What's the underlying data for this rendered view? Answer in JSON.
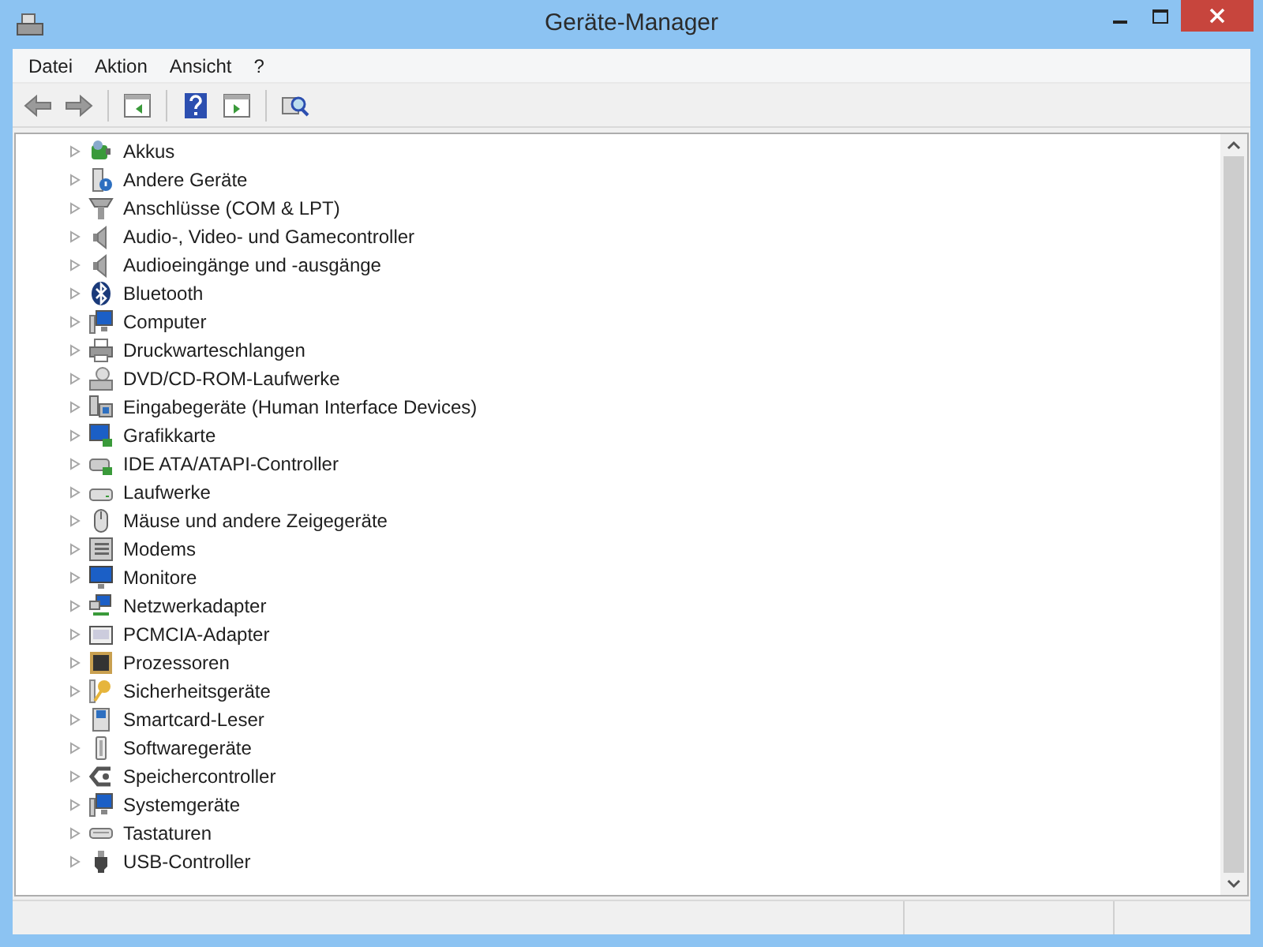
{
  "window": {
    "title": "Geräte-Manager"
  },
  "menu": [
    "Datei",
    "Aktion",
    "Ansicht",
    "?"
  ],
  "toolbar": [
    {
      "kind": "back",
      "disabled": true
    },
    {
      "kind": "forward",
      "disabled": true
    },
    {
      "kind": "sep"
    },
    {
      "kind": "tree"
    },
    {
      "kind": "sep"
    },
    {
      "kind": "help"
    },
    {
      "kind": "panel"
    },
    {
      "kind": "sep"
    },
    {
      "kind": "scan"
    }
  ],
  "tree": [
    {
      "label": "Akkus",
      "kind": "battery",
      "expanded": false
    },
    {
      "label": "Andere Geräte",
      "kind": "unknown",
      "expanded": false
    },
    {
      "label": "Anschlüsse (COM & LPT)",
      "kind": "port",
      "expanded": false
    },
    {
      "label": "Audio-, Video- und Gamecontroller",
      "kind": "speaker",
      "expanded": false
    },
    {
      "label": "Audioeingänge und -ausgänge",
      "kind": "speaker",
      "expanded": false
    },
    {
      "label": "Bluetooth",
      "kind": "bluetooth",
      "expanded": false
    },
    {
      "label": "Computer",
      "kind": "computer",
      "expanded": false
    },
    {
      "label": "Druckwarteschlangen",
      "kind": "printer",
      "expanded": false
    },
    {
      "label": "DVD/CD-ROM-Laufwerke",
      "kind": "disc",
      "expanded": false
    },
    {
      "label": "Eingabegeräte (Human Interface Devices)",
      "kind": "hid",
      "expanded": false
    },
    {
      "label": "Grafikkarte",
      "kind": "display",
      "expanded": false
    },
    {
      "label": "IDE ATA/ATAPI-Controller",
      "kind": "controller",
      "expanded": false
    },
    {
      "label": "Laufwerke",
      "kind": "drive",
      "expanded": false
    },
    {
      "label": "Mäuse und andere Zeigegeräte",
      "kind": "mouse",
      "expanded": false
    },
    {
      "label": "Modems",
      "kind": "modem",
      "expanded": false
    },
    {
      "label": "Monitore",
      "kind": "monitor",
      "expanded": false
    },
    {
      "label": "Netzwerkadapter",
      "kind": "network",
      "expanded": false
    },
    {
      "label": "PCMCIA-Adapter",
      "kind": "card",
      "expanded": false
    },
    {
      "label": "Prozessoren",
      "kind": "cpu",
      "expanded": false
    },
    {
      "label": "Sicherheitsgeräte",
      "kind": "key",
      "expanded": false
    },
    {
      "label": "Smartcard-Leser",
      "kind": "smartcard",
      "expanded": false
    },
    {
      "label": "Softwaregeräte",
      "kind": "software",
      "expanded": false
    },
    {
      "label": "Speichercontroller",
      "kind": "storage",
      "expanded": false
    },
    {
      "label": "Systemgeräte",
      "kind": "computer",
      "expanded": false
    },
    {
      "label": "Tastaturen",
      "kind": "keyboard",
      "expanded": false
    },
    {
      "label": "USB-Controller",
      "kind": "usb",
      "expanded": false
    }
  ]
}
